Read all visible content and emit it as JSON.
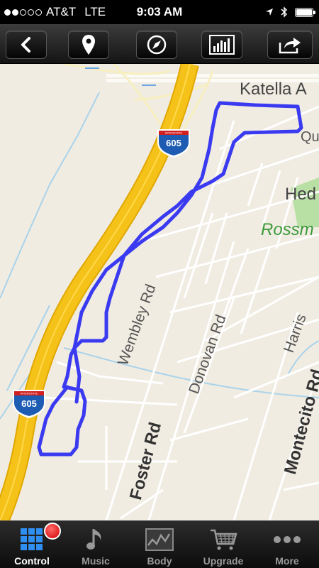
{
  "status_bar": {
    "carrier": "AT&T",
    "network": "LTE",
    "time": "9:03 AM",
    "signal_bars_filled": 2,
    "signal_bars_total": 5
  },
  "toolbar": {
    "buttons": [
      "back-icon",
      "location-pin-icon",
      "compass-icon",
      "stats-chart-icon",
      "share-icon"
    ]
  },
  "map": {
    "labels": {
      "katella": "Katella A",
      "qu": "Qu",
      "hed": "Hed",
      "rossm": "Rossm",
      "wembley": "Wembley Rd",
      "donovan": "Donovan Rd",
      "harris": "Harris",
      "montecito": "Montecito Rd",
      "foster": "Foster Rd"
    },
    "shields": [
      "605",
      "605"
    ],
    "shield_header": "INTERSTATE",
    "route_color": "#3a3af0",
    "freeway_color": "#f5c21a",
    "park_color": "#b8dfa4",
    "park_label_color": "#3a9a3a"
  },
  "tabbar": {
    "tabs": [
      {
        "label": "Control",
        "icon": "control-grid-icon",
        "active": true
      },
      {
        "label": "Music",
        "icon": "music-note-icon",
        "active": false
      },
      {
        "label": "Body",
        "icon": "body-chart-icon",
        "active": false
      },
      {
        "label": "Upgrade",
        "icon": "cart-icon",
        "active": false
      },
      {
        "label": "More",
        "icon": "more-dots-icon",
        "active": false
      }
    ]
  }
}
